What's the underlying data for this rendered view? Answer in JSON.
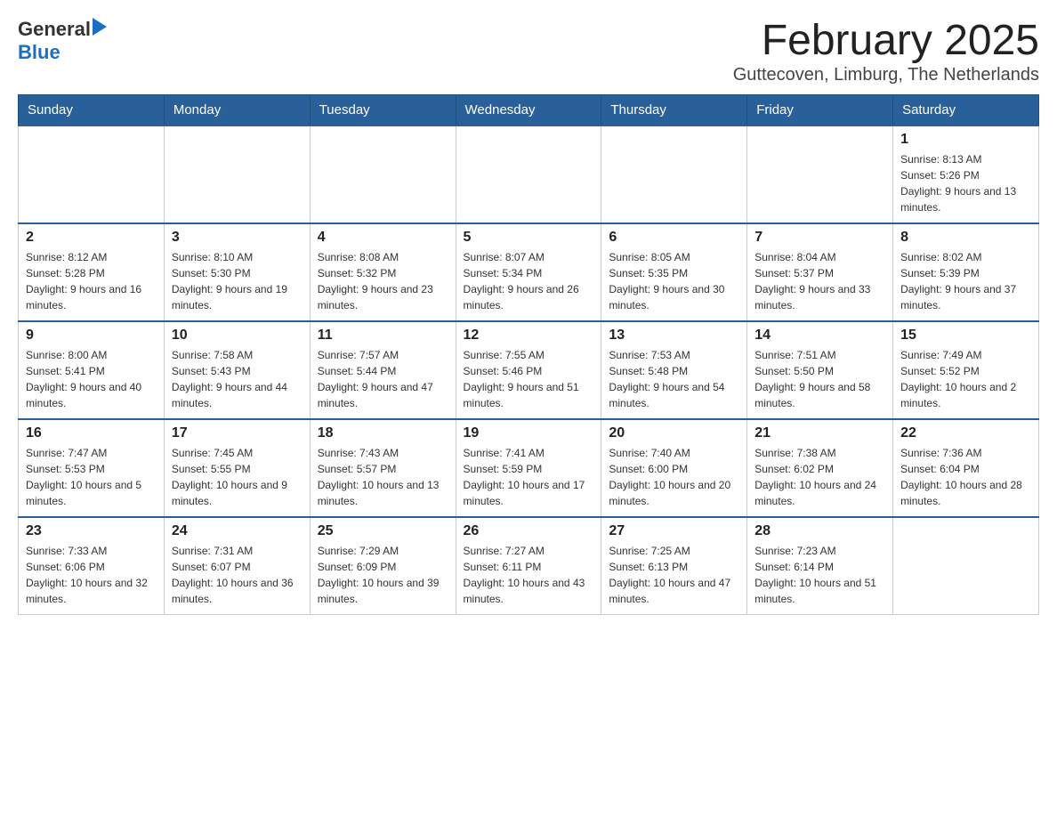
{
  "header": {
    "logo_line1": "General",
    "logo_arrow": "▶",
    "logo_line2": "Blue",
    "title": "February 2025",
    "subtitle": "Guttecoven, Limburg, The Netherlands"
  },
  "days_of_week": [
    "Sunday",
    "Monday",
    "Tuesday",
    "Wednesday",
    "Thursday",
    "Friday",
    "Saturday"
  ],
  "weeks": [
    [
      {
        "day": "",
        "info": ""
      },
      {
        "day": "",
        "info": ""
      },
      {
        "day": "",
        "info": ""
      },
      {
        "day": "",
        "info": ""
      },
      {
        "day": "",
        "info": ""
      },
      {
        "day": "",
        "info": ""
      },
      {
        "day": "1",
        "info": "Sunrise: 8:13 AM\nSunset: 5:26 PM\nDaylight: 9 hours and 13 minutes."
      }
    ],
    [
      {
        "day": "2",
        "info": "Sunrise: 8:12 AM\nSunset: 5:28 PM\nDaylight: 9 hours and 16 minutes."
      },
      {
        "day": "3",
        "info": "Sunrise: 8:10 AM\nSunset: 5:30 PM\nDaylight: 9 hours and 19 minutes."
      },
      {
        "day": "4",
        "info": "Sunrise: 8:08 AM\nSunset: 5:32 PM\nDaylight: 9 hours and 23 minutes."
      },
      {
        "day": "5",
        "info": "Sunrise: 8:07 AM\nSunset: 5:34 PM\nDaylight: 9 hours and 26 minutes."
      },
      {
        "day": "6",
        "info": "Sunrise: 8:05 AM\nSunset: 5:35 PM\nDaylight: 9 hours and 30 minutes."
      },
      {
        "day": "7",
        "info": "Sunrise: 8:04 AM\nSunset: 5:37 PM\nDaylight: 9 hours and 33 minutes."
      },
      {
        "day": "8",
        "info": "Sunrise: 8:02 AM\nSunset: 5:39 PM\nDaylight: 9 hours and 37 minutes."
      }
    ],
    [
      {
        "day": "9",
        "info": "Sunrise: 8:00 AM\nSunset: 5:41 PM\nDaylight: 9 hours and 40 minutes."
      },
      {
        "day": "10",
        "info": "Sunrise: 7:58 AM\nSunset: 5:43 PM\nDaylight: 9 hours and 44 minutes."
      },
      {
        "day": "11",
        "info": "Sunrise: 7:57 AM\nSunset: 5:44 PM\nDaylight: 9 hours and 47 minutes."
      },
      {
        "day": "12",
        "info": "Sunrise: 7:55 AM\nSunset: 5:46 PM\nDaylight: 9 hours and 51 minutes."
      },
      {
        "day": "13",
        "info": "Sunrise: 7:53 AM\nSunset: 5:48 PM\nDaylight: 9 hours and 54 minutes."
      },
      {
        "day": "14",
        "info": "Sunrise: 7:51 AM\nSunset: 5:50 PM\nDaylight: 9 hours and 58 minutes."
      },
      {
        "day": "15",
        "info": "Sunrise: 7:49 AM\nSunset: 5:52 PM\nDaylight: 10 hours and 2 minutes."
      }
    ],
    [
      {
        "day": "16",
        "info": "Sunrise: 7:47 AM\nSunset: 5:53 PM\nDaylight: 10 hours and 5 minutes."
      },
      {
        "day": "17",
        "info": "Sunrise: 7:45 AM\nSunset: 5:55 PM\nDaylight: 10 hours and 9 minutes."
      },
      {
        "day": "18",
        "info": "Sunrise: 7:43 AM\nSunset: 5:57 PM\nDaylight: 10 hours and 13 minutes."
      },
      {
        "day": "19",
        "info": "Sunrise: 7:41 AM\nSunset: 5:59 PM\nDaylight: 10 hours and 17 minutes."
      },
      {
        "day": "20",
        "info": "Sunrise: 7:40 AM\nSunset: 6:00 PM\nDaylight: 10 hours and 20 minutes."
      },
      {
        "day": "21",
        "info": "Sunrise: 7:38 AM\nSunset: 6:02 PM\nDaylight: 10 hours and 24 minutes."
      },
      {
        "day": "22",
        "info": "Sunrise: 7:36 AM\nSunset: 6:04 PM\nDaylight: 10 hours and 28 minutes."
      }
    ],
    [
      {
        "day": "23",
        "info": "Sunrise: 7:33 AM\nSunset: 6:06 PM\nDaylight: 10 hours and 32 minutes."
      },
      {
        "day": "24",
        "info": "Sunrise: 7:31 AM\nSunset: 6:07 PM\nDaylight: 10 hours and 36 minutes."
      },
      {
        "day": "25",
        "info": "Sunrise: 7:29 AM\nSunset: 6:09 PM\nDaylight: 10 hours and 39 minutes."
      },
      {
        "day": "26",
        "info": "Sunrise: 7:27 AM\nSunset: 6:11 PM\nDaylight: 10 hours and 43 minutes."
      },
      {
        "day": "27",
        "info": "Sunrise: 7:25 AM\nSunset: 6:13 PM\nDaylight: 10 hours and 47 minutes."
      },
      {
        "day": "28",
        "info": "Sunrise: 7:23 AM\nSunset: 6:14 PM\nDaylight: 10 hours and 51 minutes."
      },
      {
        "day": "",
        "info": ""
      }
    ]
  ]
}
